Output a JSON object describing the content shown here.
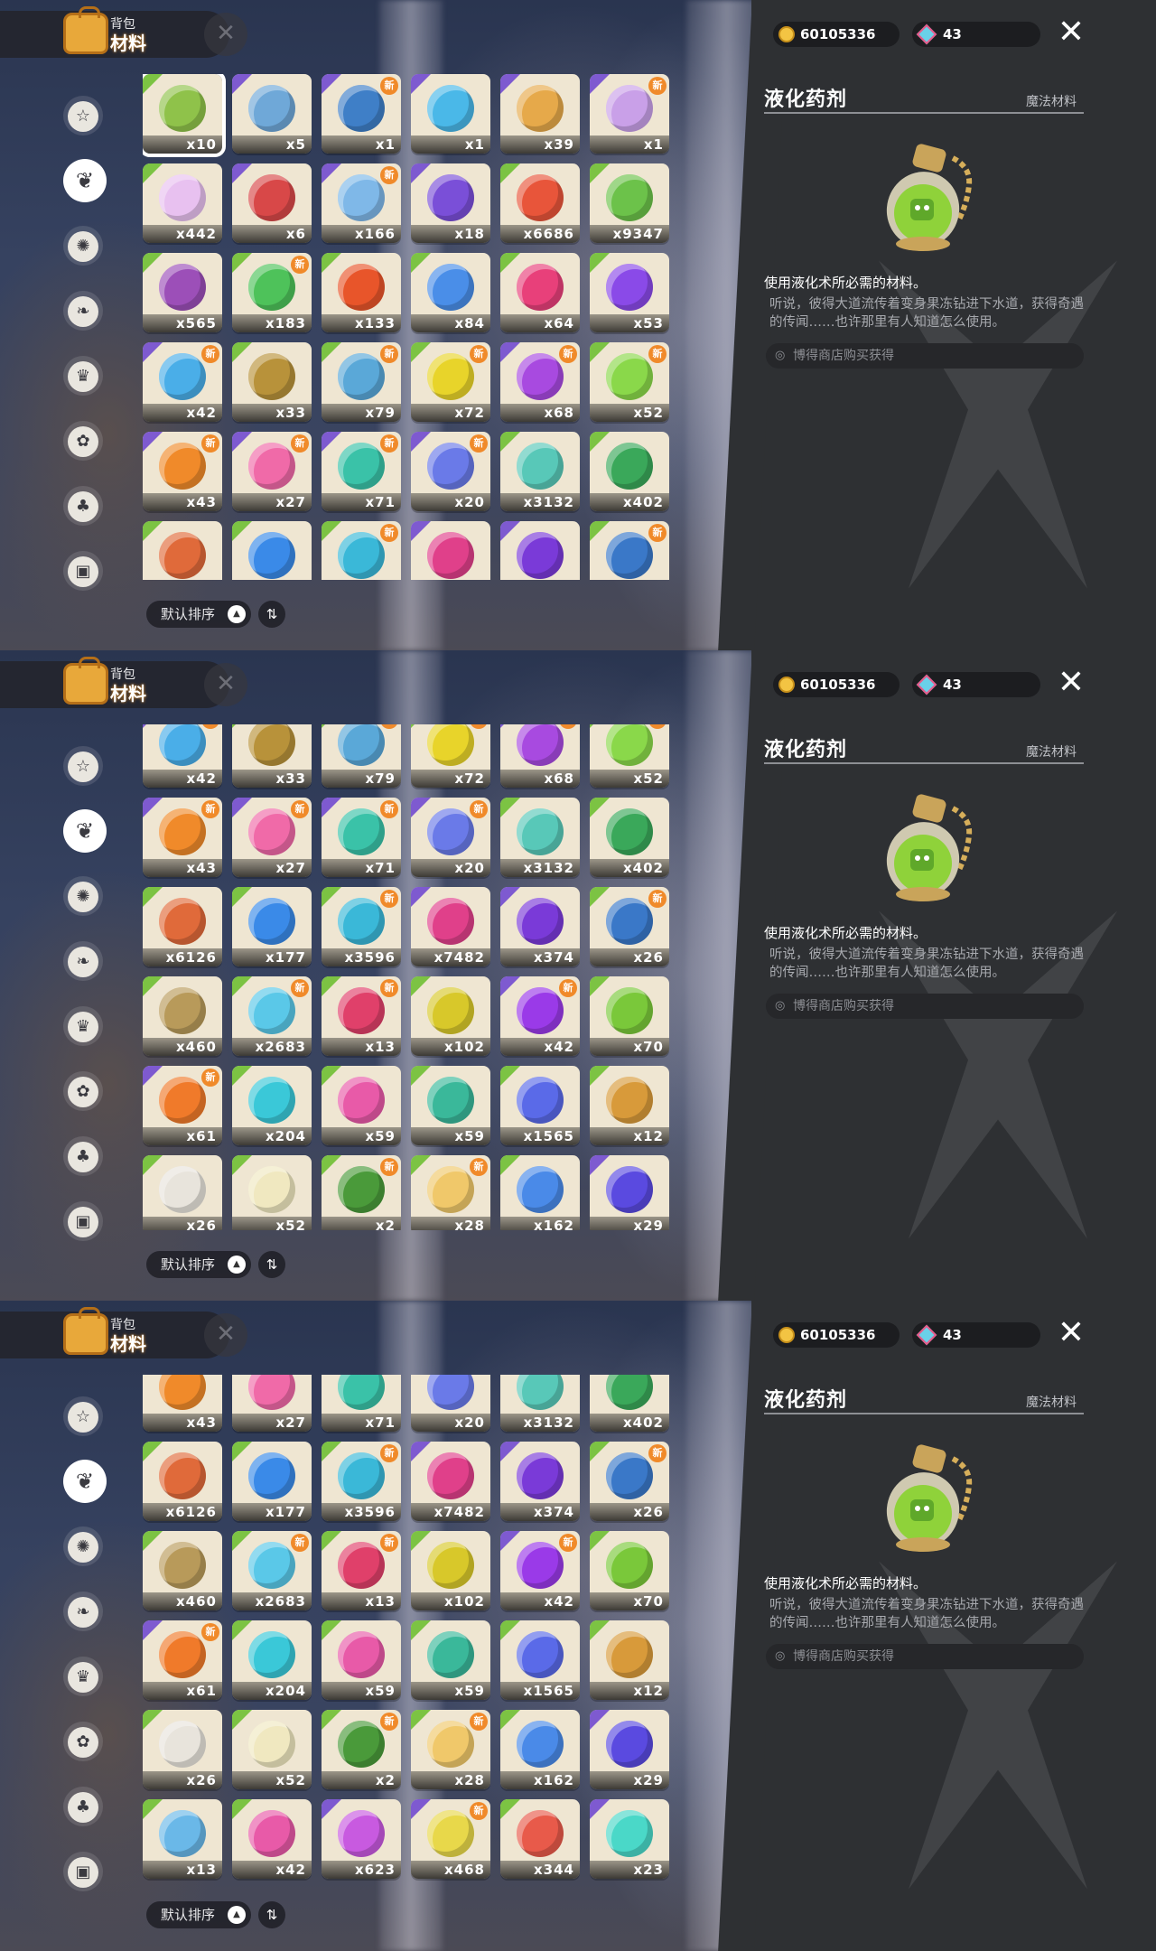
{
  "header": {
    "small": "背包",
    "big": "材料"
  },
  "currency": {
    "coins": "60105336",
    "gems": "43"
  },
  "sort": {
    "label": "默认排序",
    "dir_icon": "⇅"
  },
  "detail": {
    "title": "液化药剂",
    "category": "魔法材料",
    "short_desc": "使用液化术所必需的材料。",
    "long_desc": "听说，彼得大道流传着变身果冻钻进下水道，获得奇遇的传闻……也许那里有人知道怎么使用。",
    "source": "博得商店购买获得"
  },
  "sidebar_icons": [
    "star-tab-icon",
    "leaf-tab-icon",
    "sparkle-tab-icon",
    "plant-tab-icon",
    "crown-tab-icon",
    "flower-tab-icon",
    "acorn-tab-icon",
    "chest-tab-icon"
  ],
  "items": [
    {
      "q": "x10",
      "c": "#8fc24a",
      "new": false,
      "corner": "g"
    },
    {
      "q": "x5",
      "c": "#6fa8d8",
      "new": false,
      "corner": "p"
    },
    {
      "q": "x1",
      "c": "#3f7fc7",
      "new": true,
      "corner": "p"
    },
    {
      "q": "x1",
      "c": "#4ab8e8",
      "new": false,
      "corner": "p"
    },
    {
      "q": "x39",
      "c": "#e6a94a",
      "new": false,
      "corner": "p"
    },
    {
      "q": "x1",
      "c": "#c9a0e8",
      "new": true,
      "corner": "p"
    },
    {
      "q": "x442",
      "c": "#e8c1f0",
      "new": false,
      "corner": "g"
    },
    {
      "q": "x6",
      "c": "#d84848",
      "new": false,
      "corner": "p"
    },
    {
      "q": "x166",
      "c": "#7fb8e8",
      "new": true,
      "corner": "p"
    },
    {
      "q": "x18",
      "c": "#7a4fd8",
      "new": false,
      "corner": "p"
    },
    {
      "q": "x6686",
      "c": "#e8553a",
      "new": false,
      "corner": "g"
    },
    {
      "q": "x9347",
      "c": "#6cc24a",
      "new": false,
      "corner": "g"
    },
    {
      "q": "x565",
      "c": "#9c4fb8",
      "new": false,
      "corner": "g"
    },
    {
      "q": "x183",
      "c": "#4ec25a",
      "new": true,
      "corner": "g"
    },
    {
      "q": "x133",
      "c": "#e8552a",
      "new": false,
      "corner": "g"
    },
    {
      "q": "x84",
      "c": "#4a8ee8",
      "new": false,
      "corner": "g"
    },
    {
      "q": "x64",
      "c": "#e8407a",
      "new": false,
      "corner": "g"
    },
    {
      "q": "x53",
      "c": "#8a4ae8",
      "new": false,
      "corner": "g"
    },
    {
      "q": "x42",
      "c": "#4aaee8",
      "new": true,
      "corner": "p"
    },
    {
      "q": "x33",
      "c": "#b8923a",
      "new": false,
      "corner": "g"
    },
    {
      "q": "x79",
      "c": "#5aa8d8",
      "new": true,
      "corner": "g"
    },
    {
      "q": "x72",
      "c": "#e8d42a",
      "new": true,
      "corner": "g"
    },
    {
      "q": "x68",
      "c": "#a84ae0",
      "new": true,
      "corner": "p"
    },
    {
      "q": "x52",
      "c": "#8ad84a",
      "new": true,
      "corner": "g"
    },
    {
      "q": "x43",
      "c": "#f08a2a",
      "new": true,
      "corner": "p"
    },
    {
      "q": "x27",
      "c": "#f06aa8",
      "new": true,
      "corner": "p"
    },
    {
      "q": "x71",
      "c": "#3ac2a8",
      "new": true,
      "corner": "p"
    },
    {
      "q": "x20",
      "c": "#6a7ae8",
      "new": true,
      "corner": "p"
    },
    {
      "q": "x3132",
      "c": "#58c8b8",
      "new": false,
      "corner": "g"
    },
    {
      "q": "x402",
      "c": "#3aa85a",
      "new": false,
      "corner": "g"
    },
    {
      "q": "x6126",
      "c": "#e06a3a",
      "new": false,
      "corner": "g"
    },
    {
      "q": "x177",
      "c": "#3a8ae8",
      "new": false,
      "corner": "g"
    },
    {
      "q": "x3596",
      "c": "#3ab8d8",
      "new": true,
      "corner": "g"
    },
    {
      "q": "x7482",
      "c": "#e0408a",
      "new": false,
      "corner": "p"
    },
    {
      "q": "x374",
      "c": "#7a3ad8",
      "new": false,
      "corner": "p"
    },
    {
      "q": "x26",
      "c": "#3a78c8",
      "new": true,
      "corner": "g"
    },
    {
      "q": "x460",
      "c": "#b89a5a",
      "new": false,
      "corner": "g"
    },
    {
      "q": "x2683",
      "c": "#5ac8e8",
      "new": true,
      "corner": "g"
    },
    {
      "q": "x13",
      "c": "#e0406a",
      "new": true,
      "corner": "g"
    },
    {
      "q": "x102",
      "c": "#d8c82a",
      "new": false,
      "corner": "g"
    },
    {
      "q": "x42",
      "c": "#9a3ae8",
      "new": true,
      "corner": "p"
    },
    {
      "q": "x70",
      "c": "#7ac83a",
      "new": false,
      "corner": "g"
    },
    {
      "q": "x61",
      "c": "#f07a2a",
      "new": true,
      "corner": "p"
    },
    {
      "q": "x204",
      "c": "#3ac8d8",
      "new": false,
      "corner": "g"
    },
    {
      "q": "x59",
      "c": "#e85aa8",
      "new": false,
      "corner": "g"
    },
    {
      "q": "x59",
      "c": "#3ab89a",
      "new": false,
      "corner": "g"
    },
    {
      "q": "x1565",
      "c": "#5a6ae8",
      "new": false,
      "corner": "g"
    },
    {
      "q": "x12",
      "c": "#d89a3a",
      "new": false,
      "corner": "g"
    },
    {
      "q": "x26",
      "c": "#e8e4dc",
      "new": false,
      "corner": "g"
    },
    {
      "q": "x52",
      "c": "#f0e8c0",
      "new": false,
      "corner": "g"
    },
    {
      "q": "x2",
      "c": "#4a9a3a",
      "new": true,
      "corner": "g"
    },
    {
      "q": "x28",
      "c": "#f0c86a",
      "new": true,
      "corner": "g"
    },
    {
      "q": "x162",
      "c": "#4a8ae8",
      "new": false,
      "corner": "g"
    },
    {
      "q": "x29",
      "c": "#5a4ae0",
      "new": false,
      "corner": "p"
    },
    {
      "q": "x13",
      "c": "#6ab8e8",
      "new": false,
      "corner": "g"
    },
    {
      "q": "x42",
      "c": "#e85aa8",
      "new": false,
      "corner": "g"
    },
    {
      "q": "x623",
      "c": "#c85ae0",
      "new": false,
      "corner": "p"
    },
    {
      "q": "x468",
      "c": "#e8d84a",
      "new": true,
      "corner": "p"
    },
    {
      "q": "x344",
      "c": "#e85a4a",
      "new": false,
      "corner": "g"
    },
    {
      "q": "x23",
      "c": "#4ad8c8",
      "new": false,
      "corner": "p"
    }
  ]
}
